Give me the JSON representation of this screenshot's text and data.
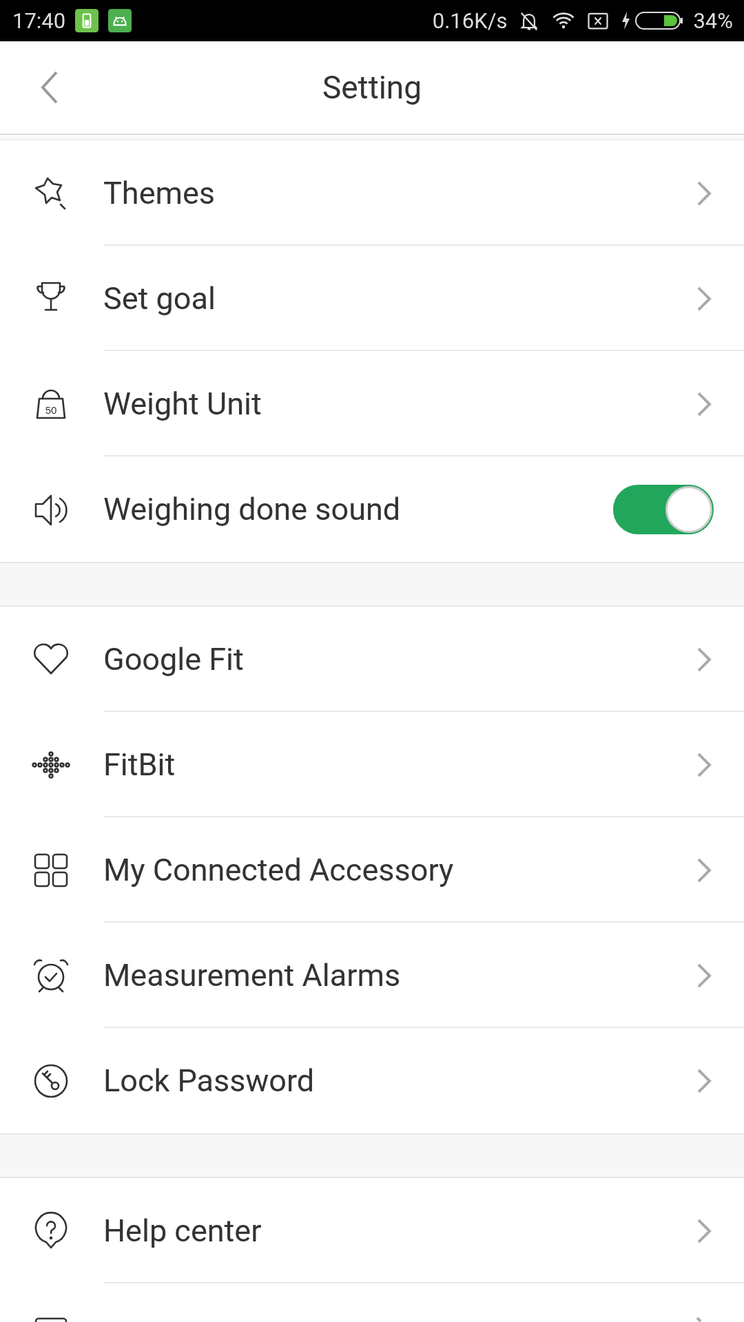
{
  "status_bar": {
    "time": "17:40",
    "speed": "0.16K/s",
    "battery": "34%"
  },
  "header": {
    "title": "Setting"
  },
  "sections": [
    {
      "rows": [
        {
          "kind": "link",
          "label": "Themes"
        },
        {
          "kind": "link",
          "label": "Set goal"
        },
        {
          "kind": "link",
          "label": "Weight Unit",
          "icon_text": "50"
        },
        {
          "kind": "toggle",
          "label": "Weighing done sound",
          "on": true
        }
      ]
    },
    {
      "rows": [
        {
          "kind": "link",
          "label": "Google Fit"
        },
        {
          "kind": "link",
          "label": "FitBit"
        },
        {
          "kind": "link",
          "label": "My Connected Accessory"
        },
        {
          "kind": "link",
          "label": "Measurement Alarms"
        },
        {
          "kind": "link",
          "label": "Lock Password"
        }
      ]
    },
    {
      "rows": [
        {
          "kind": "link",
          "label": "Help center"
        },
        {
          "kind": "link"
        }
      ]
    }
  ]
}
